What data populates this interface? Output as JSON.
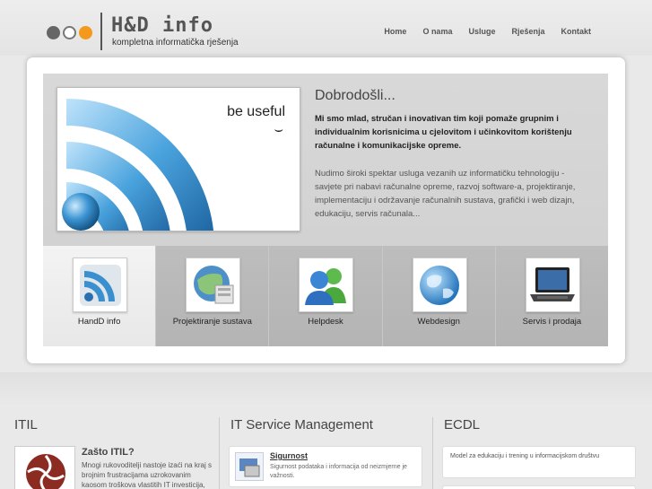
{
  "logo": {
    "title": "H&D info",
    "subtitle": "kompletna informatička rješenja"
  },
  "nav": {
    "items": [
      "Home",
      "O nama",
      "Usluge",
      "Rješenja",
      "Kontakt"
    ]
  },
  "hero": {
    "image_tagline": "be useful",
    "image_smiley": "⌣",
    "title": "Dobrodošli...",
    "intro": "Mi smo mlad, stručan i inovativan tim koji pomaže grupnim i individualnim korisnicima u cjelovitom i učinkovitom korištenju računalne i komunikacijske opreme.",
    "description": "Nudimo široki spektar usluga vezanih uz informatičku tehnologiju - savjete pri nabavi računalne opreme, razvoj software-a, projektiranje, implementaciju i održavanje računalnih sustava, grafički i web dizajn, edukaciju, servis računala..."
  },
  "services": [
    {
      "label": "HandD info",
      "icon": "rss-icon"
    },
    {
      "label": "Projektiranje sustava",
      "icon": "network-globe-icon"
    },
    {
      "label": "Helpdesk",
      "icon": "users-icon"
    },
    {
      "label": "Webdesign",
      "icon": "globe-icon"
    },
    {
      "label": "Servis i prodaja",
      "icon": "laptop-icon"
    }
  ],
  "itil": {
    "title": "ITIL",
    "heading": "Zašto ITIL?",
    "text": "Mnogi rukovoditelji nastoje izaći na kraj s brojnim frustracijama uzrokovanim kaosom troškova vlastitih IT investicija,"
  },
  "itsm": {
    "title": "IT Service Management",
    "card_heading": "Sigurnost",
    "card_text": "Sigurnost podataka i informacija od neizmjerne je važnosti."
  },
  "ecdl": {
    "title": "ECDL",
    "card_text": "Model za edukaciju i trening u informacijskom društvu"
  },
  "colors": {
    "accent_orange": "#f39a1d",
    "rss_blue": "#2f8fd0"
  }
}
